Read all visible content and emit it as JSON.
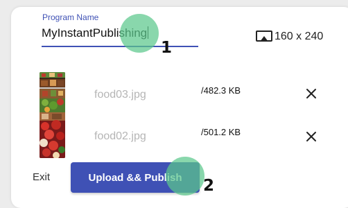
{
  "form": {
    "program_name_label": "Program Name",
    "program_name_value": "MyInstantPublishing"
  },
  "display": {
    "resolution": "160 x 240",
    "icon": "cast-icon"
  },
  "files": [
    {
      "name": "food03.jpg",
      "size": "/482.3 KB"
    },
    {
      "name": "food02.jpg",
      "size": "/501.2 KB"
    }
  ],
  "actions": {
    "exit_label": "Exit",
    "publish_label": "Upload && Publish"
  },
  "annotations": {
    "step1": "1",
    "step2": "2"
  },
  "colors": {
    "accent": "#3f51b5",
    "highlight": "#5cc88c"
  }
}
